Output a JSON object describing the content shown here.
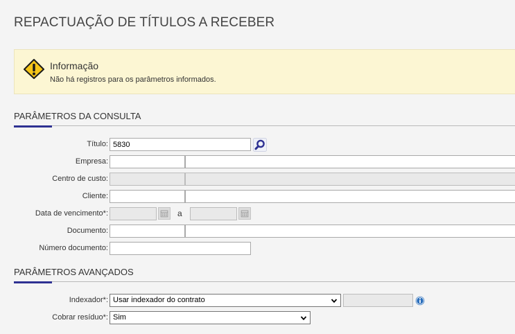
{
  "page": {
    "title": "REPACTUAÇÃO DE TÍTULOS A RECEBER"
  },
  "info": {
    "title": "Informação",
    "message": "Não há registros para os parâmetros informados.",
    "icon": "warning-icon"
  },
  "sections": {
    "consulta": "PARÂMETROS DA CONSULTA",
    "avancados": "PARÂMETROS AVANÇADOS"
  },
  "form": {
    "titulo": {
      "label": "Título:",
      "value": "5830"
    },
    "empresa": {
      "label": "Empresa:",
      "code": "",
      "name": ""
    },
    "centro_custo": {
      "label": "Centro de custo:",
      "code": "",
      "name": ""
    },
    "cliente": {
      "label": "Cliente:",
      "code": "",
      "name": ""
    },
    "data_vencimento": {
      "label": "Data de vencimento*:",
      "from": "",
      "between": "a",
      "to": ""
    },
    "documento": {
      "label": "Documento:",
      "code": "",
      "name": ""
    },
    "numero_documento": {
      "label": "Número documento:",
      "value": ""
    },
    "indexador": {
      "label": "Indexador*:",
      "value": "Usar indexador do contrato",
      "extra": ""
    },
    "cobrar_residuo": {
      "label": "Cobrar resíduo*:",
      "value": "Sim"
    }
  },
  "colors": {
    "accent": "#2e3192",
    "info_bg": "#fcf6d3",
    "help_icon": "#2a6ebb"
  }
}
